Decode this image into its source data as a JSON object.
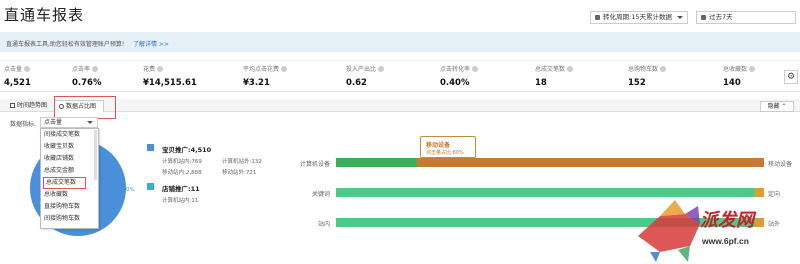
{
  "header": {
    "title": "直通车报表",
    "period_select": "转化周期:15天累计数据",
    "range_select": "过去7天"
  },
  "notice": {
    "text": "直通车报表工具,助您轻松有效管理账户预算!",
    "link": "了解详情 >>"
  },
  "metrics": [
    {
      "label": "点击量",
      "value": "4,521"
    },
    {
      "label": "点击率",
      "value": "0.76%"
    },
    {
      "label": "花费",
      "value": "¥14,515.61"
    },
    {
      "label": "平均点击花费",
      "value": "¥3.21"
    },
    {
      "label": "投入产出比",
      "value": "0.62"
    },
    {
      "label": "点击转化率",
      "value": "0.40%"
    },
    {
      "label": "总成交笔数",
      "value": "18"
    },
    {
      "label": "总购物车数",
      "value": "152"
    },
    {
      "label": "总收藏数",
      "value": "140"
    }
  ],
  "tabs": {
    "trend": "时间趋势图",
    "ratio": "数据占比图",
    "hide": "隐藏"
  },
  "dimension": {
    "label": "数据指标:",
    "selected": "点击量",
    "options": [
      "间接成交笔数",
      "收藏宝贝数",
      "收藏店铺数",
      "总成交金额",
      "总成交笔数",
      "总收藏数",
      "直接购物车数",
      "间接购物车数"
    ]
  },
  "pie": {
    "percent_label": "0%",
    "legend": [
      {
        "title": "宝贝推广:4,510",
        "sub1": "计算机站内:769",
        "sub2": "计算机站外:132",
        "sub3": "移动站内:2,888",
        "sub4": "移动站外:721",
        "color": "#4a8fd9"
      },
      {
        "title": "店铺推广:11",
        "sub1": "计算机站内:11",
        "color": "#3aaed8"
      }
    ]
  },
  "chart_data": {
    "type": "bar",
    "categories": [
      "计算机设备",
      "关键词",
      "站内"
    ],
    "series": [
      {
        "name": "",
        "values": [
          19,
          98,
          98
        ]
      },
      {
        "name": "移动设备",
        "values": [
          81,
          2,
          2
        ]
      }
    ],
    "right_labels": [
      "移动设备",
      "定向",
      "站外"
    ],
    "tooltip": {
      "title": "移动设备",
      "detail": "点击量占比:80%"
    },
    "colors": [
      "#3fae5a",
      "#c77b32",
      "#4fc98a",
      "#e09a3a"
    ]
  },
  "watermark": {
    "brand": "派发网",
    "url": "www.6pf.cn"
  }
}
